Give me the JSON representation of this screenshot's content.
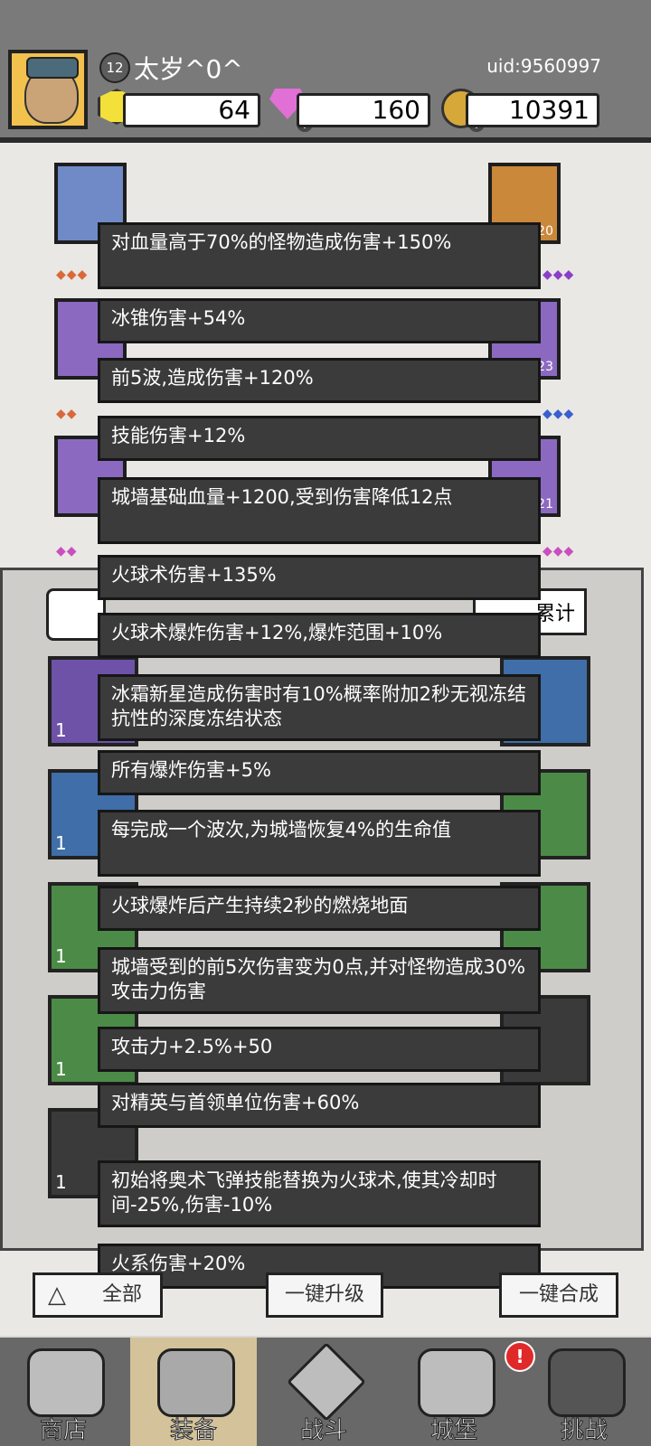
{
  "player": {
    "level": "12",
    "name": "太岁^0^",
    "uid": "uid:9560997"
  },
  "resources": {
    "gems": "64",
    "diamonds": "160",
    "coins": "10391"
  },
  "equipment_levels": {
    "right_top": "v.20",
    "right_mid": "v.23",
    "right_bot": "v.21"
  },
  "stats_label": "累计",
  "item_counts": [
    "1",
    "1",
    "1",
    "1",
    "1"
  ],
  "tooltip_lines": [
    "对血量高于70%的怪物造成伤害+150%",
    "冰锥伤害+54%",
    "前5波,造成伤害+120%",
    "技能伤害+12%",
    "城墙基础血量+1200,受到伤害降低12点",
    "火球术伤害+135%",
    "火球术爆炸伤害+12%,爆炸范围+10%",
    "冰霜新星造成伤害时有10%概率附加2秒无视冻结抗性的深度冻结状态",
    "所有爆炸伤害+5%",
    "每完成一个波次,为城墙恢复4%的生命值",
    "火球爆炸后产生持续2秒的燃烧地面",
    "城墙受到的前5次伤害变为0点,并对怪物造成30%攻击力伤害",
    "攻击力+2.5%+50",
    "对精英与首领单位伤害+60%",
    "初始将奥术飞弹技能替换为火球术,使其冷却时间-25%,伤害-10%",
    "火系伤害+20%"
  ],
  "bottom_buttons": {
    "filter": "全部",
    "upgrade": "一键升级",
    "merge": "一键合成"
  },
  "nav": {
    "shop": "商店",
    "equip": "装备",
    "battle": "战斗",
    "castle": "城堡",
    "challenge": "挑战",
    "alert": "!"
  }
}
